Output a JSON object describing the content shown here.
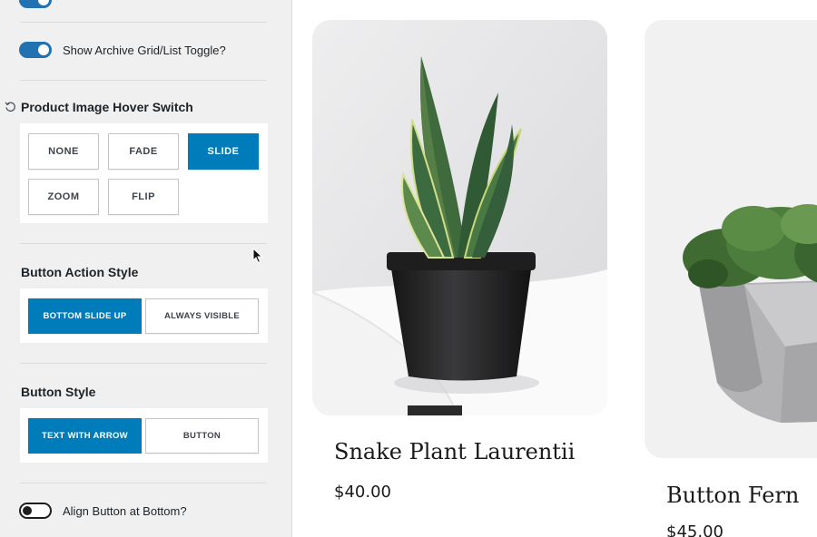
{
  "panel": {
    "archive_toggle": {
      "label": "Show Archive Grid/List Toggle?",
      "on": true
    },
    "hover_switch": {
      "title": "Product Image Hover Switch",
      "options": [
        "NONE",
        "FADE",
        "SLIDE",
        "ZOOM",
        "FLIP"
      ],
      "selected": "SLIDE"
    },
    "button_action": {
      "title": "Button Action Style",
      "options": [
        "BOTTOM SLIDE UP",
        "ALWAYS VISIBLE"
      ],
      "selected": "BOTTOM SLIDE UP"
    },
    "button_style": {
      "title": "Button Style",
      "options": [
        "TEXT WITH ARROW",
        "BUTTON"
      ],
      "selected": "TEXT WITH ARROW"
    },
    "align_toggle": {
      "label": "Align Button at Bottom?",
      "on": false
    }
  },
  "products": [
    {
      "name": "Snake Plant Laurentii",
      "price": "$40.00"
    },
    {
      "name": "Button Fern",
      "price": "$45.00"
    }
  ],
  "colors": {
    "accent": "#007cba",
    "toggle_on": "#2271b1",
    "panel_bg": "#f0f0f1"
  }
}
